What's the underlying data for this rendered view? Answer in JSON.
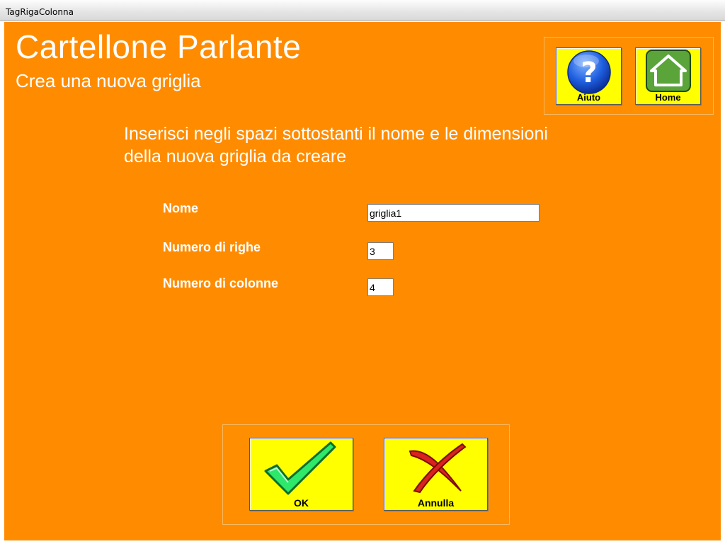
{
  "window": {
    "title": "TagRigaColonna"
  },
  "header": {
    "title": "Cartellone Parlante",
    "subtitle": "Crea una nuova griglia"
  },
  "toolbar": {
    "help_label": "Aiuto",
    "home_label": "Home"
  },
  "instructions": "Inserisci negli spazi sottostanti il nome e le dimensioni della nuova griglia da creare",
  "form": {
    "name_label": "Nome",
    "name_value": "griglia1",
    "rows_label": "Numero di righe",
    "rows_value": "3",
    "cols_label": "Numero di colonne",
    "cols_value": "4"
  },
  "actions": {
    "ok_label": "OK",
    "cancel_label": "Annulla"
  },
  "colors": {
    "background": "#ff8c00",
    "button": "#ffff00",
    "text": "#ffffff"
  },
  "icons": {
    "help": "question-mark-icon",
    "home": "house-icon",
    "ok": "checkmark-icon",
    "cancel": "cross-icon"
  }
}
